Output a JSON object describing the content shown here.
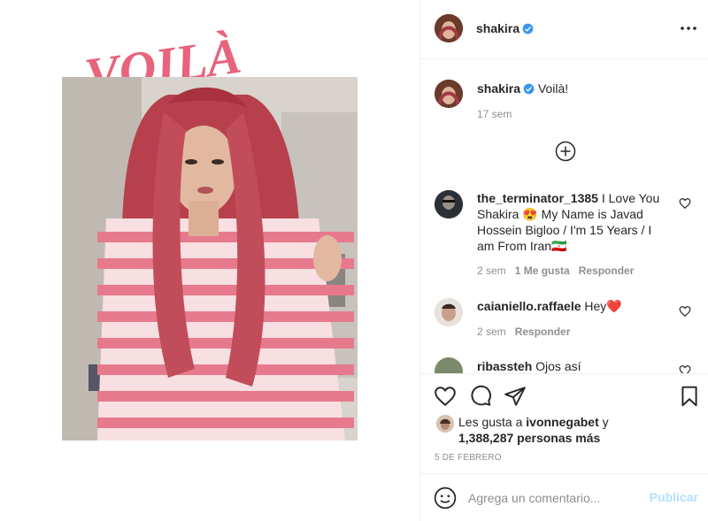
{
  "post": {
    "title_overlay": "VOILÀ"
  },
  "header": {
    "username": "shakira",
    "verified_icon": "verified-badge-icon",
    "more_icon": "more-options-icon"
  },
  "caption": {
    "username": "shakira",
    "text": "Voilà!",
    "time": "17 sem"
  },
  "load_more_icon": "plus-circle-icon",
  "comments": [
    {
      "username": "the_terminator_1385",
      "text": "I Love You Shakira 😍 My Name is Javad Hossein Bigloo / I'm 15 Years / I am From Iran🇮🇷",
      "time": "2 sem",
      "likes": "1 Me gusta",
      "reply": "Responder"
    },
    {
      "username": "caianiello.raffaele",
      "text": "Hey❤️",
      "time": "2 sem",
      "reply": "Responder"
    },
    {
      "username": "ribassteh",
      "text": "Ojos así"
    }
  ],
  "likes": {
    "prefix": "Les gusta a",
    "user": "ivonnegabet",
    "connector": "y",
    "count": "1,388,287 personas más"
  },
  "date": "5 DE FEBRERO",
  "composer": {
    "placeholder": "Agrega un comentario...",
    "publish": "Publicar"
  },
  "colors": {
    "verified": "#3897f0",
    "publish_disabled": "#b2dffc",
    "meta": "#8e8e8e",
    "voila_pink": "#e8637c"
  }
}
